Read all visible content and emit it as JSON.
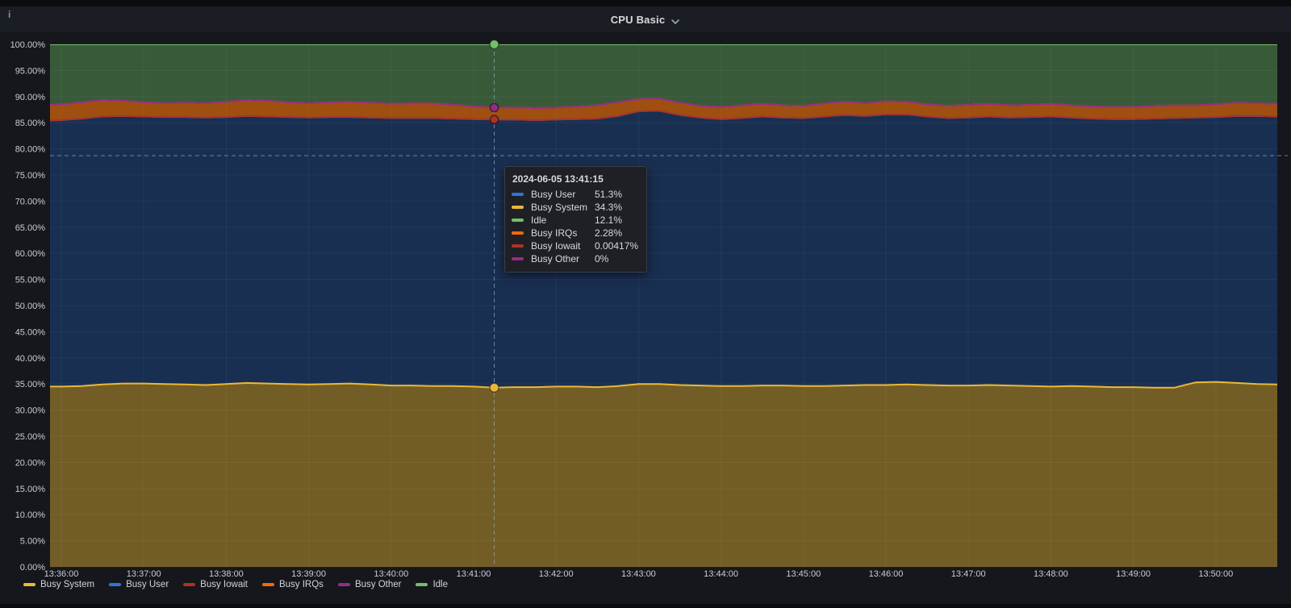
{
  "panel": {
    "title": "CPU Basic",
    "info_icon": "i"
  },
  "colors": {
    "page_bg": "#15171c",
    "header_bg": "#1a1d23",
    "plot_bg": "#0f1217",
    "grid": "rgba(210,220,235,0.07)",
    "axis_text": "#c9ced4",
    "crosshair": "#9fb1c2",
    "tooltip_bg": "#1e2025"
  },
  "axes": {
    "y_tick_labels": [
      "100.00%",
      "95.00%",
      "90.00%",
      "85.00%",
      "80.00%",
      "75.00%",
      "70.00%",
      "65.00%",
      "60.00%",
      "55.00%",
      "50.00%",
      "45.00%",
      "40.00%",
      "35.00%",
      "30.00%",
      "25.00%",
      "20.00%",
      "15.00%",
      "10.00%",
      "5.00%",
      "0.00%"
    ],
    "x_tick_labels": [
      "13:36:00",
      "13:37:00",
      "13:38:00",
      "13:39:00",
      "13:40:00",
      "13:41:00",
      "13:42:00",
      "13:43:00",
      "13:44:00",
      "13:45:00",
      "13:46:00",
      "13:47:00",
      "13:48:00",
      "13:49:00",
      "13:50:00"
    ]
  },
  "legend": {
    "items": [
      {
        "label": "Busy System",
        "color": "#EAB839"
      },
      {
        "label": "Busy User",
        "color": "#3274D9"
      },
      {
        "label": "Busy Iowait",
        "color": "#AE3224"
      },
      {
        "label": "Busy IRQs",
        "color": "#F2690D"
      },
      {
        "label": "Busy Other",
        "color": "#962D82"
      },
      {
        "label": "Idle",
        "color": "#73BF69"
      }
    ]
  },
  "tooltip": {
    "timestamp": "2024-06-05 13:41:15",
    "rows": [
      {
        "label": "Busy User",
        "value": "51.3%",
        "color": "#3274D9"
      },
      {
        "label": "Busy System",
        "value": "34.3%",
        "color": "#EAB839"
      },
      {
        "label": "Idle",
        "value": "12.1%",
        "color": "#73BF69"
      },
      {
        "label": "Busy IRQs",
        "value": "2.28%",
        "color": "#F2690D"
      },
      {
        "label": "Busy Iowait",
        "value": "0.00417%",
        "color": "#AE3224"
      },
      {
        "label": "Busy Other",
        "value": "0%",
        "color": "#962D82"
      }
    ]
  },
  "chart_data": {
    "type": "area",
    "stacked": true,
    "unit": "percent",
    "title": "CPU Basic",
    "ylim": [
      0,
      100
    ],
    "y_tick_step": 5,
    "grid": true,
    "legend_position": "bottom",
    "x_start_time": "13:35:45",
    "x_end_time": "13:50:45",
    "x_step_seconds": 15,
    "x_axis_tick_times": [
      "13:36:00",
      "13:37:00",
      "13:38:00",
      "13:39:00",
      "13:40:00",
      "13:41:00",
      "13:42:00",
      "13:43:00",
      "13:44:00",
      "13:45:00",
      "13:46:00",
      "13:47:00",
      "13:48:00",
      "13:49:00",
      "13:50:00"
    ],
    "cursor": {
      "time": "2024-06-05 13:41:15",
      "index": 22,
      "pointer_percent_y": 78.7
    },
    "series": [
      {
        "name": "Busy System",
        "color": "#EAB839",
        "fill": "rgba(234,184,57,0.46)",
        "values": [
          34.5,
          34.5,
          34.6,
          34.9,
          35.1,
          35.1,
          35.0,
          34.9,
          34.8,
          35.0,
          35.2,
          35.1,
          35.0,
          34.9,
          35.0,
          35.1,
          34.9,
          34.7,
          34.7,
          34.6,
          34.6,
          34.5,
          34.3,
          34.4,
          34.4,
          34.5,
          34.5,
          34.4,
          34.6,
          35.0,
          35.0,
          34.8,
          34.7,
          34.6,
          34.6,
          34.7,
          34.7,
          34.6,
          34.6,
          34.7,
          34.8,
          34.8,
          34.9,
          34.8,
          34.7,
          34.7,
          34.8,
          34.7,
          34.6,
          34.5,
          34.6,
          34.5,
          34.4,
          34.4,
          34.3,
          34.3,
          35.3,
          35.4,
          35.2,
          35.0,
          34.9
        ]
      },
      {
        "name": "Busy User",
        "color": "#3274D9",
        "fill": "rgba(50,116,217,0.30)",
        "values": [
          50.9,
          51.0,
          51.2,
          51.3,
          51.2,
          51.1,
          51.1,
          51.2,
          51.2,
          51.1,
          51.1,
          51.1,
          51.1,
          51.1,
          51.1,
          51.0,
          51.1,
          51.2,
          51.2,
          51.3,
          51.2,
          51.2,
          51.3,
          51.2,
          51.1,
          51.1,
          51.2,
          51.4,
          51.7,
          52.2,
          52.3,
          51.7,
          51.3,
          51.1,
          51.3,
          51.5,
          51.3,
          51.3,
          51.6,
          51.8,
          51.5,
          51.8,
          51.7,
          51.4,
          51.2,
          51.3,
          51.4,
          51.3,
          51.5,
          51.7,
          51.4,
          51.3,
          51.3,
          51.3,
          51.5,
          51.6,
          50.7,
          50.7,
          51.1,
          51.3,
          51.3
        ]
      },
      {
        "name": "Busy Iowait",
        "color": "#AE3224",
        "fill": "rgba(174,50,36,0.5)",
        "constant": 0.00417
      },
      {
        "name": "Busy IRQs",
        "color": "#F2690D",
        "fill": "rgba(255,120,10,0.6)",
        "values": [
          2.9,
          3.0,
          3.1,
          3.1,
          2.9,
          2.7,
          2.6,
          2.7,
          2.7,
          2.9,
          3.0,
          3.0,
          2.8,
          2.7,
          2.8,
          2.9,
          2.8,
          2.7,
          2.8,
          2.8,
          2.6,
          2.4,
          2.28,
          2.3,
          2.3,
          2.3,
          2.4,
          2.5,
          2.6,
          2.3,
          2.3,
          2.3,
          2.2,
          2.3,
          2.4,
          2.4,
          2.3,
          2.3,
          2.5,
          2.5,
          2.4,
          2.5,
          2.4,
          2.3,
          2.3,
          2.4,
          2.4,
          2.3,
          2.3,
          2.4,
          2.3,
          2.3,
          2.3,
          2.3,
          2.4,
          2.4,
          2.3,
          2.4,
          2.5,
          2.4,
          2.4
        ]
      },
      {
        "name": "Busy Other",
        "color": "#962D82",
        "fill": "rgba(150,45,130,0.5)",
        "constant": 0
      },
      {
        "name": "Idle",
        "color": "#73BF69",
        "fill": "rgba(115,191,105,0.42)",
        "remainder": true
      }
    ]
  }
}
